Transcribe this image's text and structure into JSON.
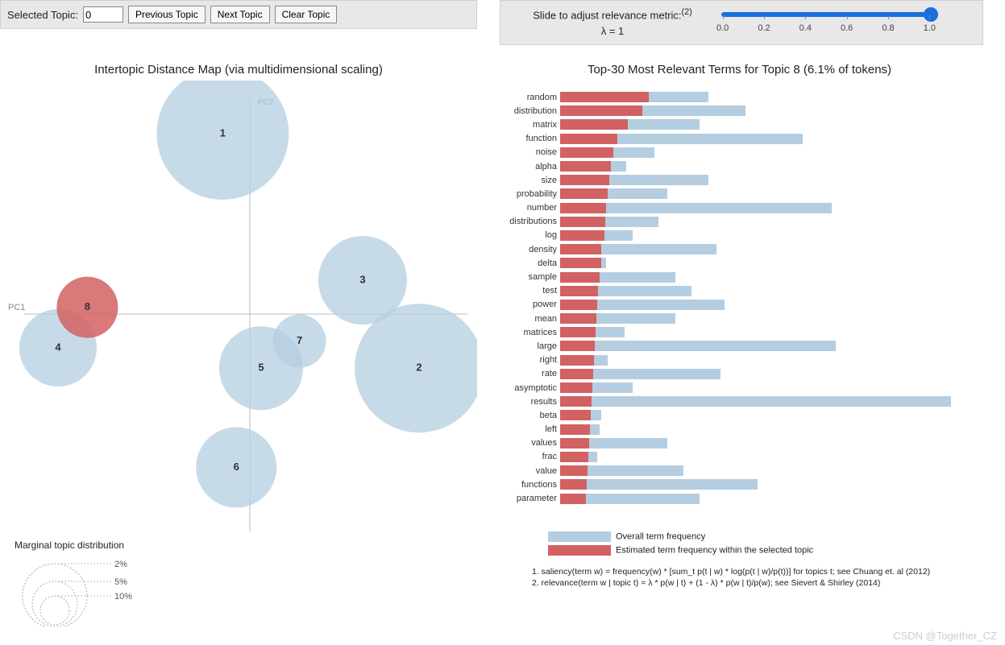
{
  "toolbar": {
    "selected_label": "Selected Topic:",
    "selected_value": "0",
    "prev_label": "Previous Topic",
    "next_label": "Next Topic",
    "clear_label": "Clear Topic"
  },
  "slider": {
    "line1": "Slide to adjust relevance metric:",
    "sup": "(2)",
    "line2": "λ = 1",
    "ticks": [
      "0.0",
      "0.2",
      "0.4",
      "0.6",
      "0.8",
      "1.0"
    ]
  },
  "left_title": "Intertopic Distance Map (via multidimensional scaling)",
  "right_title": "Top-30 Most Relevant Terms for Topic 8 (6.1% of tokens)",
  "axes": {
    "x": "PC1",
    "y": "PC2"
  },
  "chart_data": {
    "type": "scatter",
    "topics": [
      {
        "id": 1,
        "x": -0.12,
        "y": 0.8,
        "r": 82,
        "selected": false
      },
      {
        "id": 2,
        "x": 0.75,
        "y": -0.24,
        "r": 80,
        "selected": false
      },
      {
        "id": 3,
        "x": 0.5,
        "y": 0.15,
        "r": 55,
        "selected": false
      },
      {
        "id": 4,
        "x": -0.85,
        "y": -0.15,
        "r": 48,
        "selected": false
      },
      {
        "id": 5,
        "x": 0.05,
        "y": -0.24,
        "r": 52,
        "selected": false
      },
      {
        "id": 6,
        "x": -0.06,
        "y": -0.68,
        "r": 50,
        "selected": false
      },
      {
        "id": 7,
        "x": 0.22,
        "y": -0.12,
        "r": 33,
        "selected": false
      },
      {
        "id": 8,
        "x": -0.72,
        "y": 0.03,
        "r": 38,
        "selected": true
      }
    ],
    "terms": [
      {
        "term": "random",
        "overall": 180,
        "topic": 108
      },
      {
        "term": "distribution",
        "overall": 225,
        "topic": 100
      },
      {
        "term": "matrix",
        "overall": 170,
        "topic": 82
      },
      {
        "term": "function",
        "overall": 295,
        "topic": 70
      },
      {
        "term": "noise",
        "overall": 115,
        "topic": 65
      },
      {
        "term": "alpha",
        "overall": 80,
        "topic": 62
      },
      {
        "term": "size",
        "overall": 180,
        "topic": 60
      },
      {
        "term": "probability",
        "overall": 130,
        "topic": 58
      },
      {
        "term": "number",
        "overall": 330,
        "topic": 56
      },
      {
        "term": "distributions",
        "overall": 120,
        "topic": 55
      },
      {
        "term": "log",
        "overall": 88,
        "topic": 54
      },
      {
        "term": "density",
        "overall": 190,
        "topic": 50
      },
      {
        "term": "delta",
        "overall": 56,
        "topic": 50
      },
      {
        "term": "sample",
        "overall": 140,
        "topic": 48
      },
      {
        "term": "test",
        "overall": 160,
        "topic": 46
      },
      {
        "term": "power",
        "overall": 200,
        "topic": 45
      },
      {
        "term": "mean",
        "overall": 140,
        "topic": 44
      },
      {
        "term": "matrices",
        "overall": 78,
        "topic": 43
      },
      {
        "term": "large",
        "overall": 335,
        "topic": 42
      },
      {
        "term": "right",
        "overall": 58,
        "topic": 41
      },
      {
        "term": "rate",
        "overall": 195,
        "topic": 40
      },
      {
        "term": "asymptotic",
        "overall": 88,
        "topic": 39
      },
      {
        "term": "results",
        "overall": 475,
        "topic": 38
      },
      {
        "term": "beta",
        "overall": 50,
        "topic": 37
      },
      {
        "term": "left",
        "overall": 48,
        "topic": 36
      },
      {
        "term": "values",
        "overall": 130,
        "topic": 35
      },
      {
        "term": "frac",
        "overall": 45,
        "topic": 34
      },
      {
        "term": "value",
        "overall": 150,
        "topic": 33
      },
      {
        "term": "functions",
        "overall": 240,
        "topic": 32
      },
      {
        "term": "parameter",
        "overall": 170,
        "topic": 31
      }
    ],
    "bar_xmax": 500
  },
  "marginal_legend": {
    "title": "Marginal topic distribution",
    "labels": [
      "2%",
      "5%",
      "10%"
    ]
  },
  "bar_legend": {
    "overall": "Overall term frequency",
    "topic": "Estimated term frequency within the selected topic"
  },
  "formulas": {
    "f1": "1. saliency(term w) = frequency(w) * [sum_t p(t | w) * log(p(t | w)/p(t))] for topics t; see Chuang et. al (2012)",
    "f2": "2. relevance(term w | topic t) = λ * p(w | t) + (1 - λ) * p(w | t)/p(w); see Sievert & Shirley (2014)"
  },
  "watermark": "CSDN @Together_CZ"
}
